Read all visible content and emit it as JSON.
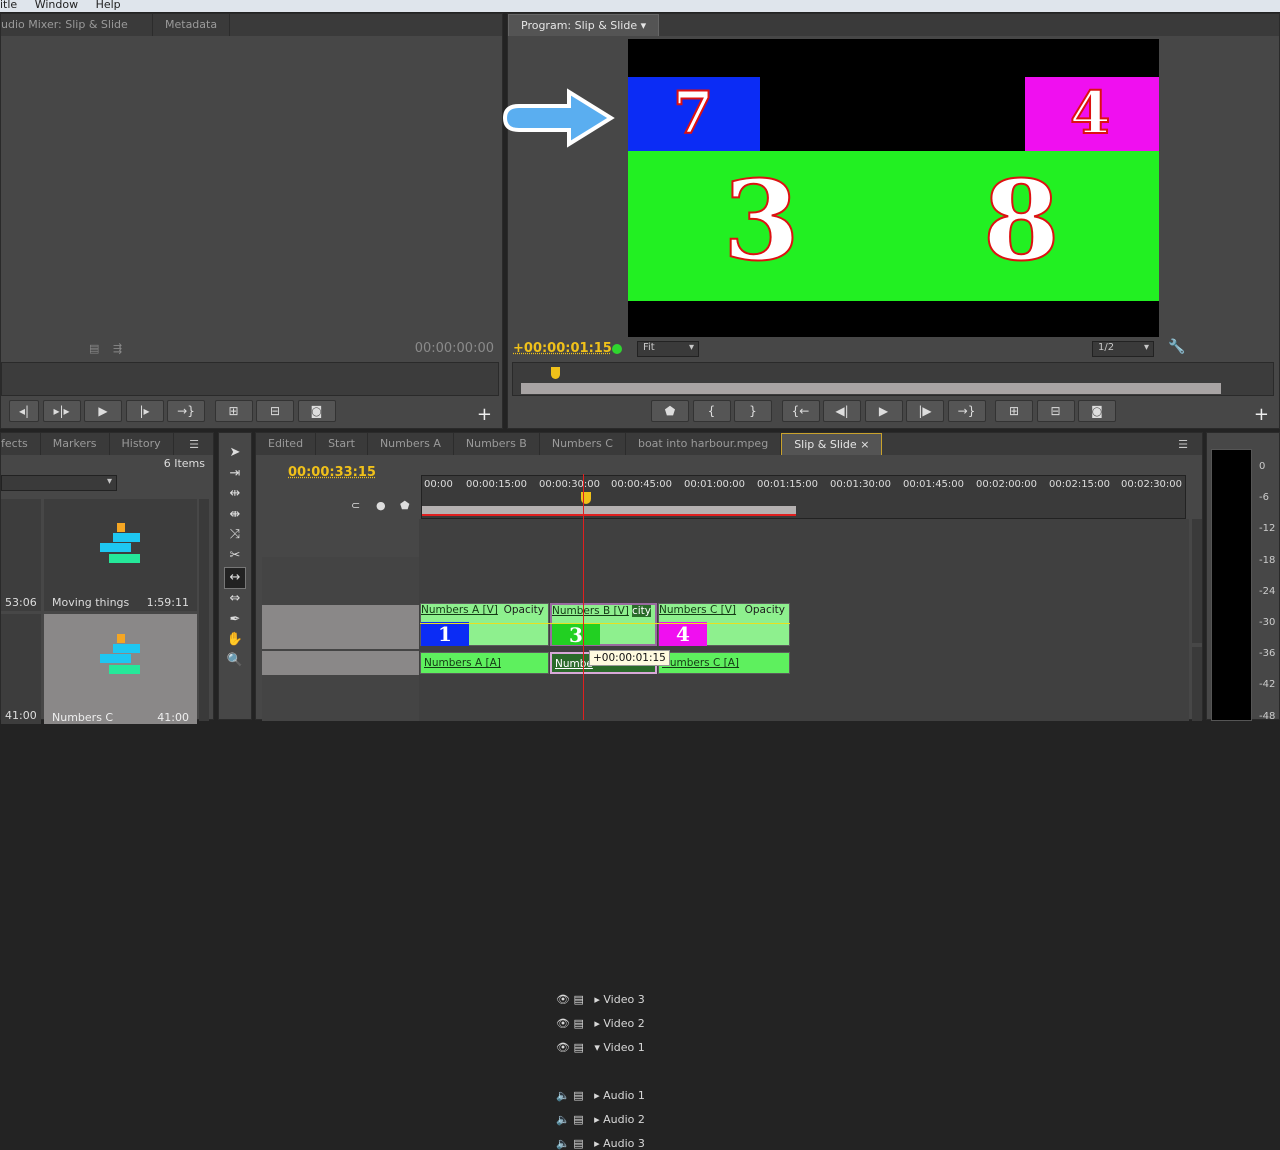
{
  "menu": [
    "itle",
    "Window",
    "Help"
  ],
  "source_panel": {
    "tabs": [
      "udio Mixer: Slip & Slide",
      "Metadata"
    ],
    "timecode": "00:00:00:00"
  },
  "program_panel": {
    "tab": "Program: Slip & Slide",
    "timecode": "+00:00:01:15",
    "fit": "Fit",
    "resolution": "1/2",
    "frame": {
      "top_left_number": "7",
      "top_right_number": "4",
      "bottom_left_number": "3",
      "bottom_right_number": "8",
      "colors": {
        "blue": "#0b2cf5",
        "magenta": "#f00ff0",
        "green": "#22f022"
      }
    },
    "buttons": [
      "add-marker",
      "mark-in",
      "mark-out",
      "go-to-in",
      "step-back",
      "play",
      "step-forward",
      "go-to-out",
      "lift",
      "extract",
      "export-frame"
    ]
  },
  "project_panel": {
    "tabs": [
      "fects",
      "Markers",
      "History"
    ],
    "item_count": "6 Items",
    "items": [
      {
        "name": "",
        "duration": "53:06"
      },
      {
        "name": "Moving things",
        "duration": "1:59:11"
      },
      {
        "name": "",
        "duration": "41:00"
      },
      {
        "name": "Numbers C",
        "duration": "41:00"
      }
    ]
  },
  "tools": [
    "selection",
    "track-select",
    "ripple-edit",
    "rolling-edit",
    "rate-stretch",
    "razor",
    "slip",
    "slide",
    "pen",
    "hand",
    "zoom"
  ],
  "timeline": {
    "tabs": [
      "Edited",
      "Start",
      "Numbers A",
      "Numbers B",
      "Numbers C",
      "boat into harbour.mpeg",
      "Slip & Slide"
    ],
    "timecode": "00:00:33:15",
    "ruler": [
      "00:00",
      "00:00:15:00",
      "00:00:30:00",
      "00:00:45:00",
      "00:01:00:00",
      "00:01:15:00",
      "00:01:30:00",
      "00:01:45:00",
      "00:02:00:00",
      "00:02:15:00",
      "00:02:30:00"
    ],
    "tracks": [
      "Video 3",
      "Video 2",
      "Video 1",
      "Audio 1",
      "Audio 2",
      "Audio 3"
    ],
    "video_clips": [
      {
        "label": "Numbers A [V]",
        "fx": "Opacity",
        "num": "1"
      },
      {
        "label": "Numbers B [V]",
        "fx": "city",
        "num": "3"
      },
      {
        "label": "Numbers C [V]",
        "fx": "Opacity",
        "num": "4"
      }
    ],
    "audio_clips": [
      "Numbers A [A]",
      "Numbe",
      "Numbers C [A]"
    ],
    "tooltip": "+00:00:01:15"
  },
  "meter": {
    "scale": [
      "0",
      "-6",
      "-12",
      "-18",
      "-24",
      "-30",
      "-36",
      "-42",
      "-48"
    ]
  }
}
